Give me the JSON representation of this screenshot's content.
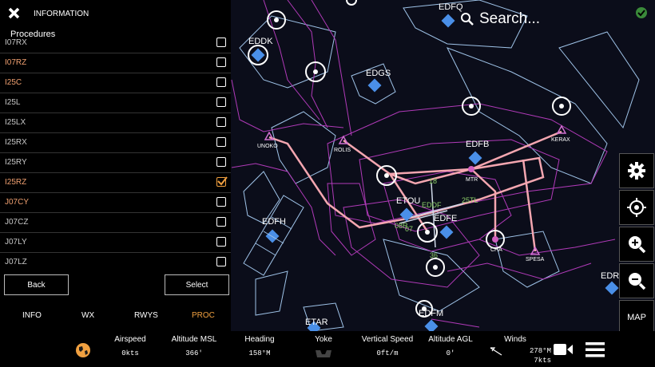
{
  "panel": {
    "title": "INFORMATION",
    "subtitle": "Procedures",
    "procedures": [
      {
        "label": "I07RX",
        "checked": false,
        "highlight": false
      },
      {
        "label": "I07RZ",
        "checked": false,
        "highlight": true
      },
      {
        "label": "I25C",
        "checked": false,
        "highlight": true
      },
      {
        "label": "I25L",
        "checked": false,
        "highlight": false
      },
      {
        "label": "I25LX",
        "checked": false,
        "highlight": false
      },
      {
        "label": "I25RX",
        "checked": false,
        "highlight": false
      },
      {
        "label": "I25RY",
        "checked": false,
        "highlight": false
      },
      {
        "label": "I25RZ",
        "checked": true,
        "highlight": true
      },
      {
        "label": "J07CY",
        "checked": false,
        "highlight": true
      },
      {
        "label": "J07CZ",
        "checked": false,
        "highlight": false
      },
      {
        "label": "J07LY",
        "checked": false,
        "highlight": false
      },
      {
        "label": "J07LZ",
        "checked": false,
        "highlight": false
      }
    ],
    "back_label": "Back",
    "select_label": "Select",
    "tabs": [
      {
        "label": "INFO",
        "active": false
      },
      {
        "label": "WX",
        "active": false
      },
      {
        "label": "RWYS",
        "active": false
      },
      {
        "label": "PROC",
        "active": true
      }
    ]
  },
  "search": {
    "placeholder": "Search..."
  },
  "map": {
    "airports": [
      "EDFQ",
      "EDDK",
      "EDGS",
      "EDFB",
      "ETOU",
      "EDFE",
      "EDFH",
      "ETAR",
      "EDFM",
      "EDRG"
    ],
    "waypoints": [
      "UNOKO",
      "ROLIS",
      "KERAX",
      "MTR",
      "CHA",
      "SPESA"
    ],
    "runway_labels": [
      "18",
      "25TL",
      "07",
      "36",
      "08R",
      "EDDF"
    ]
  },
  "right_buttons": {
    "map_label": "MAP"
  },
  "bottom": {
    "airspeed": {
      "title": "Airspeed",
      "value": "0kts"
    },
    "altitude_msl": {
      "title": "Altitude MSL",
      "value": "366'"
    },
    "heading": {
      "title": "Heading",
      "value": "158°M"
    },
    "yoke": {
      "title": "Yoke"
    },
    "vertical_speed": {
      "title": "Vertical Speed",
      "value": "0ft/m"
    },
    "altitude_agl": {
      "title": "Altitude AGL",
      "value": "0'"
    },
    "winds": {
      "title": "Winds",
      "direction": "278°M",
      "speed": "7kts"
    }
  },
  "colors": {
    "accent": "#f0a040",
    "route": "#f4a6b0",
    "airspace": "#c040c0",
    "airport": "#4a90e8"
  }
}
